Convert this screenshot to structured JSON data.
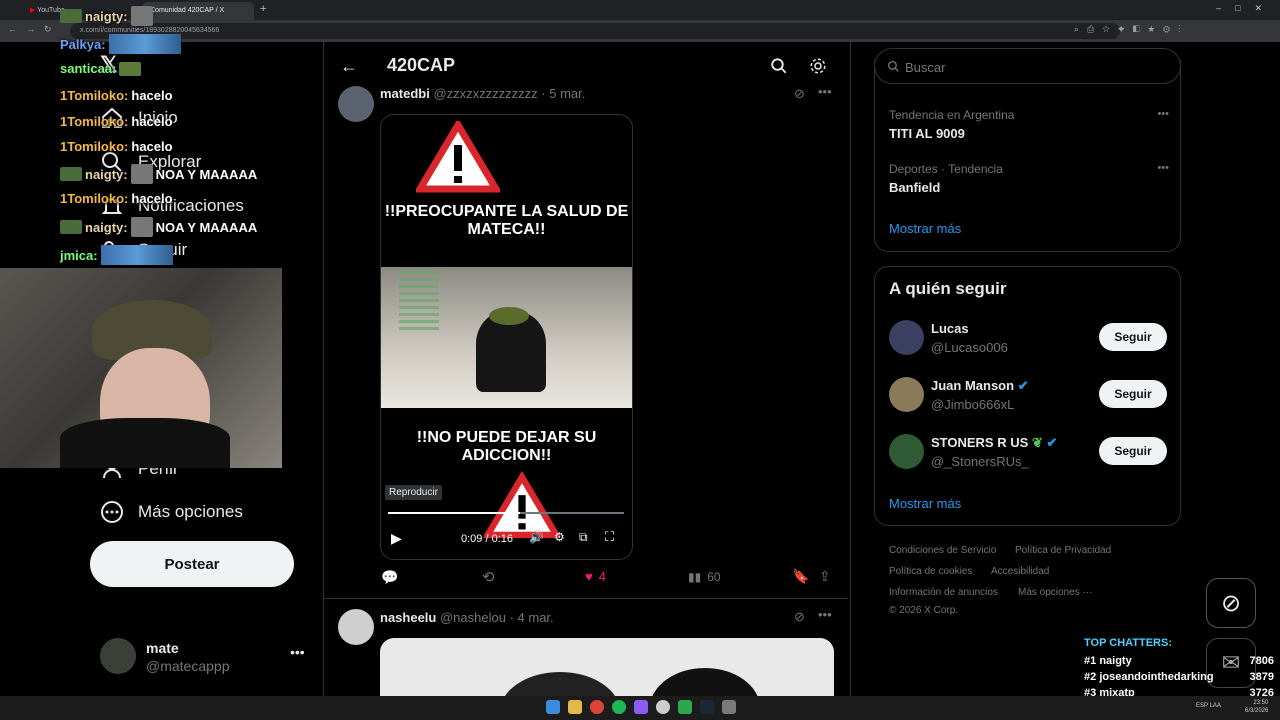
{
  "browser": {
    "tabs": [
      "YouTube",
      "Comunidad 420CAP / X"
    ],
    "url": "x.com/i/communities/1893028820045634566"
  },
  "nav": {
    "items": [
      "Inicio",
      "Explorar",
      "Notificaciones",
      "Seguir",
      "Perfil",
      "Más opciones"
    ],
    "post_label": "Postear",
    "account": {
      "name": "mate",
      "handle": "@matecappp"
    }
  },
  "feed": {
    "title": "420CAP",
    "post1": {
      "name": "matedbi",
      "handle": "@zzxzxzzzzzzzzz",
      "date": "· 5 mar.",
      "headline_top": "!!PREOCUPANTE LA SALUD DE MATECA!!",
      "headline_bottom": "!!NO PUEDE DEJAR SU ADICCION!!",
      "tooltip": "Reproducir",
      "time": "0:09 / 0:16",
      "progress": 0.56,
      "likes": "4",
      "views": "60"
    },
    "post2": {
      "name": "nasheelu",
      "handle": "@nashelou",
      "date": "· 4 mar."
    }
  },
  "right": {
    "search_placeholder": "Buscar",
    "trends": [
      {
        "context": "Tendencia en Argentina",
        "name": "TITI AL 9009"
      },
      {
        "context": "Deportes · Tendencia",
        "name": "Banfield"
      }
    ],
    "trends_more": "Mostrar más",
    "follow_title": "A quién seguir",
    "follow": [
      {
        "name": "Lucas",
        "handle": "@Lucaso006",
        "button": "Seguir"
      },
      {
        "name": "Juan Manson",
        "handle": "@Jimbo666xL",
        "button": "Seguir"
      },
      {
        "name": "STONERS R US",
        "handle": "@_StonersRUs_",
        "button": "Seguir"
      }
    ],
    "follow_more": "Mostrar más",
    "footer": [
      "Condiciones de Servicio",
      "Política de Privacidad",
      "Política de cookies",
      "Accesibilidad",
      "Información de anuncios",
      "Más opciones ···",
      "© 2026 X Corp."
    ]
  },
  "overlay": {
    "chat": [
      {
        "user": "naigty:",
        "msg": ""
      },
      {
        "user": "Palkya:",
        "msg": ""
      },
      {
        "user": "santicaa:",
        "msg": ""
      },
      {
        "user": "1Tomiloko:",
        "msg": "hacelo"
      },
      {
        "user": "1Tomiloko:",
        "msg": "hacelo"
      },
      {
        "user": "1Tomiloko:",
        "msg": "hacelo"
      },
      {
        "user": "naigty:",
        "msg": "NOA Y MAAAAA"
      },
      {
        "user": "1Tomiloko:",
        "msg": "hacelo"
      },
      {
        "user": "naigty:",
        "msg": "NOA Y MAAAAA"
      },
      {
        "user": "jmica:",
        "msg": ""
      }
    ],
    "top_chatters_title": "TOP CHATTERS:",
    "top_chatters": [
      {
        "rank": "#1",
        "name": "naigty",
        "count": "7806"
      },
      {
        "rank": "#2",
        "name": "joseandointhedarking",
        "count": "3879"
      },
      {
        "rank": "#3",
        "name": "mixatp",
        "count": "3726"
      }
    ]
  },
  "taskbar": {
    "lang": "ESP LAA",
    "time": "23:50",
    "date": "6/3/2026"
  },
  "colors": {
    "accent": "#1d9bf0",
    "like": "#f91880",
    "background": "#000000"
  }
}
